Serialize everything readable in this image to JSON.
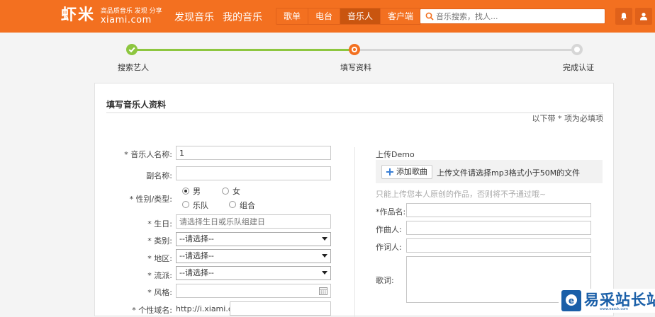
{
  "header": {
    "logo_main": "虾米",
    "logo_slogan": "高品质音乐 发现 分享",
    "logo_domain": "xiami.com",
    "nav_discover": "发现音乐",
    "nav_mine": "我的音乐",
    "tabs": [
      "歌单",
      "电台",
      "音乐人",
      "客户端"
    ],
    "active_tab": "音乐人",
    "search_placeholder": "音乐搜索，找人...",
    "brand_color": "#f37020"
  },
  "steps": [
    {
      "label": "搜索艺人",
      "state": "done"
    },
    {
      "label": "填写资料",
      "state": "current"
    },
    {
      "label": "完成认证",
      "state": "todo"
    }
  ],
  "form": {
    "title": "填写音乐人资料",
    "required_note": "以下带 * 项为必填项",
    "name_label": "* 音乐人名称:",
    "name_value": "1",
    "alias_label": "副名称:",
    "alias_value": "",
    "type_label": "* 性别/类型:",
    "type_options": [
      "男",
      "女",
      "乐队",
      "组合"
    ],
    "type_selected": "男",
    "birthday_label": "* 生日:",
    "birthday_placeholder": "请选择生日或乐队组建日",
    "category_label": "* 类别:",
    "category_value": "--请选择--",
    "region_label": "* 地区:",
    "region_value": "--请选择--",
    "genre_label": "* 流派:",
    "genre_value": "--请选择--",
    "style_label": "* 风格:",
    "style_value": "",
    "domain_label": "* 个性域名:",
    "domain_prefix": "http://i.xiami.com/"
  },
  "upload": {
    "title": "上传Demo",
    "add_button": "添加歌曲",
    "hint": "上传文件请选择mp3格式小于50M的文件",
    "note": "只能上传您本人原创的作品，否则将不予通过哦~",
    "work_label": "*作品名:",
    "composer_label": "作曲人:",
    "lyricist_label": "作词人:",
    "lyrics_label": "歌词:"
  },
  "watermark": {
    "text": "易采站长站",
    "sub": "www.easck.com"
  }
}
